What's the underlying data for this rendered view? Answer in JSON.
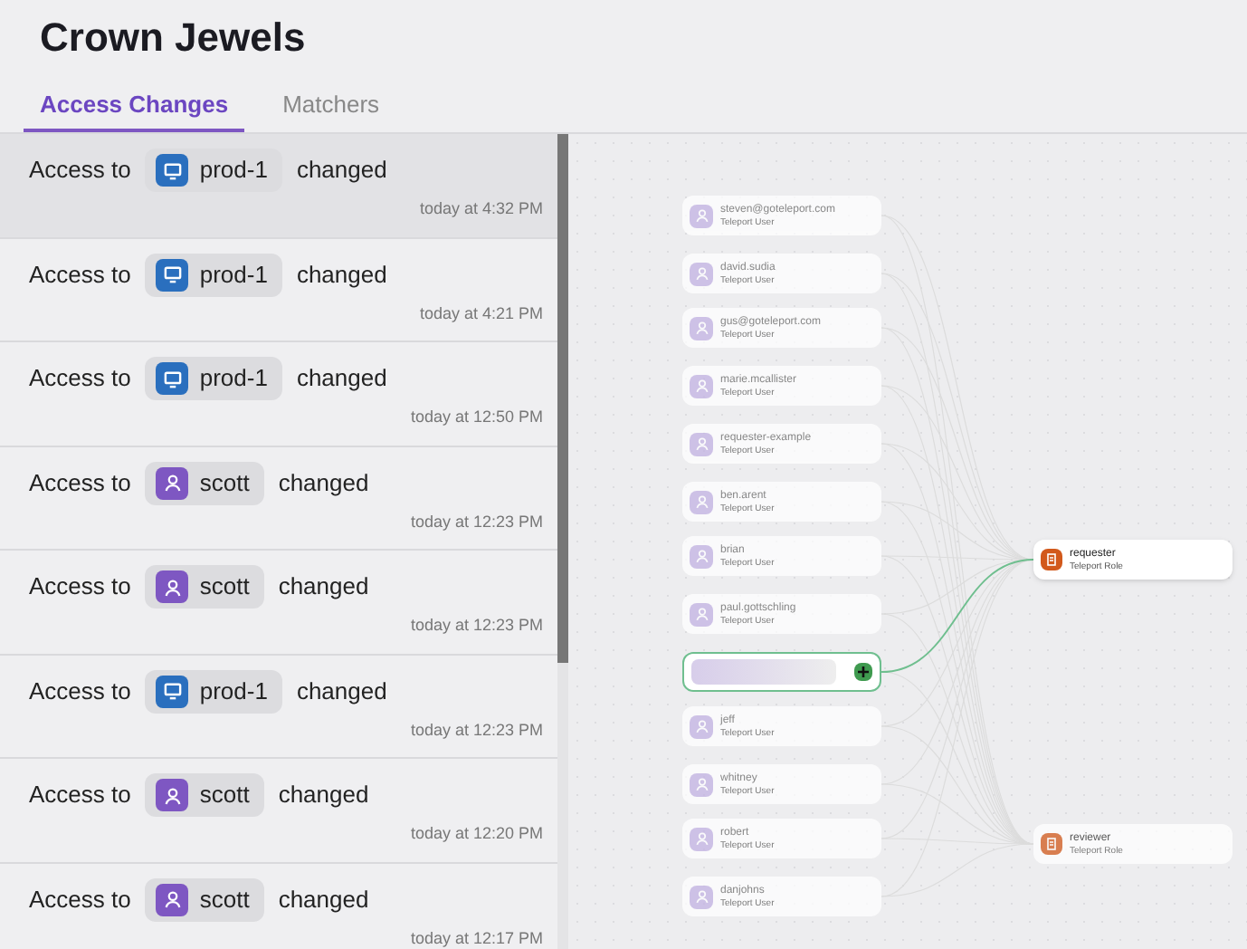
{
  "title": "Crown Jewels",
  "tabs": [
    {
      "label": "Access Changes",
      "selected": true
    },
    {
      "label": "Matchers",
      "selected": false
    }
  ],
  "changes": [
    {
      "prefix": "Access to",
      "resource": {
        "kind": "server",
        "name": "prod-1"
      },
      "suffix": "changed",
      "time": "today at 4:32 PM",
      "selected": true
    },
    {
      "prefix": "Access to",
      "resource": {
        "kind": "server",
        "name": "prod-1"
      },
      "suffix": "changed",
      "time": "today at 4:21 PM",
      "selected": false
    },
    {
      "prefix": "Access to",
      "resource": {
        "kind": "server",
        "name": "prod-1"
      },
      "suffix": "changed",
      "time": "today at 12:50 PM",
      "selected": false
    },
    {
      "prefix": "Access to",
      "resource": {
        "kind": "user",
        "name": "scott"
      },
      "suffix": "changed",
      "time": "today at 12:23 PM",
      "selected": false
    },
    {
      "prefix": "Access to",
      "resource": {
        "kind": "user",
        "name": "scott"
      },
      "suffix": "changed",
      "time": "today at 12:23 PM",
      "selected": false
    },
    {
      "prefix": "Access to",
      "resource": {
        "kind": "server",
        "name": "prod-1"
      },
      "suffix": "changed",
      "time": "today at 12:23 PM",
      "selected": false
    },
    {
      "prefix": "Access to",
      "resource": {
        "kind": "user",
        "name": "scott"
      },
      "suffix": "changed",
      "time": "today at 12:20 PM",
      "selected": false
    },
    {
      "prefix": "Access to",
      "resource": {
        "kind": "user",
        "name": "scott"
      },
      "suffix": "changed",
      "time": "today at 12:17 PM",
      "selected": false
    }
  ],
  "graph": {
    "users": [
      {
        "kind": "user",
        "name": "steven@goteleport.com",
        "subtitle": "Teleport User",
        "selected": false
      },
      {
        "kind": "user",
        "name": "david.sudia",
        "subtitle": "Teleport User",
        "selected": false
      },
      {
        "kind": "user",
        "name": "gus@goteleport.com",
        "subtitle": "Teleport User",
        "selected": false
      },
      {
        "kind": "user",
        "name": "marie.mcallister",
        "subtitle": "Teleport User",
        "selected": false
      },
      {
        "kind": "user",
        "name": "requester-example",
        "subtitle": "Teleport User",
        "selected": false
      },
      {
        "kind": "user",
        "name": "ben.arent",
        "subtitle": "Teleport User",
        "selected": false
      },
      {
        "kind": "user",
        "name": "brian",
        "subtitle": "Teleport User",
        "selected": false
      },
      {
        "kind": "user",
        "name": "paul.gottschling",
        "subtitle": "Teleport User",
        "selected": false
      },
      {
        "kind": "redacted",
        "selected": true
      },
      {
        "kind": "user",
        "name": "jeff",
        "subtitle": "Teleport User",
        "selected": false
      },
      {
        "kind": "user",
        "name": "whitney",
        "subtitle": "Teleport User",
        "selected": false
      },
      {
        "kind": "user",
        "name": "robert",
        "subtitle": "Teleport User",
        "selected": false
      },
      {
        "kind": "user",
        "name": "danjohns",
        "subtitle": "Teleport User",
        "selected": false
      }
    ],
    "roles": [
      {
        "name": "requester",
        "subtitle": "Teleport Role",
        "selected": true
      },
      {
        "name": "reviewer",
        "subtitle": "Teleport Role",
        "selected": false
      }
    ]
  }
}
